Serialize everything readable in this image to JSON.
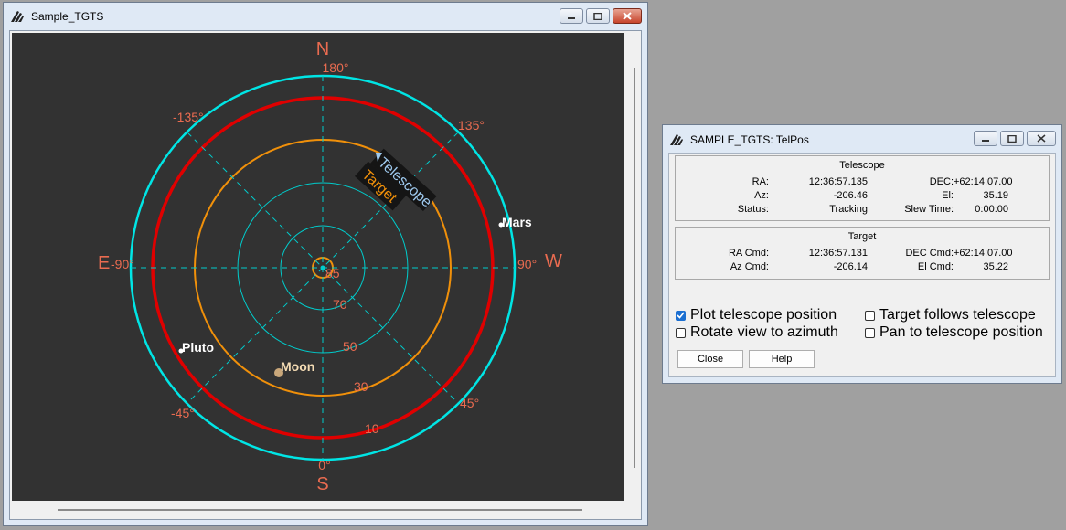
{
  "main_window": {
    "title": "Sample_TGTS",
    "polar": {
      "cardinal": {
        "north": "N",
        "south": "S",
        "east": "E",
        "west": "W"
      },
      "az_labels": {
        "top": "180°",
        "bottom": "0°",
        "left": "-90°",
        "right": "90°",
        "upper_left": "-135°",
        "upper_right": "135°",
        "lower_left": "-45°",
        "lower_right": "45°"
      },
      "el_labels": [
        "85",
        "70",
        "50",
        "30",
        "10"
      ],
      "tags": {
        "telescope": "Telescope",
        "target": "Target"
      },
      "bodies": {
        "mars": "Mars",
        "pluto": "Pluto",
        "moon": "Moon"
      },
      "colors": {
        "outer_ring": "#00e5e5",
        "red_ring": "#e00000",
        "orange_ring": "#f0900a",
        "grid": "#00cccc",
        "labels": "#e96b50"
      }
    }
  },
  "telpos_window": {
    "title": "SAMPLE_TGTS: TelPos",
    "telescope": {
      "heading": "Telescope",
      "ra_label": "RA:",
      "ra_value": "12:36:57.135",
      "dec_label": "DEC:",
      "dec_value": "+62:14:07.00",
      "az_label": "Az:",
      "az_value": "-206.46",
      "el_label": "El:",
      "el_value": "35.19",
      "status_label": "Status:",
      "status_value": "Tracking",
      "slew_label": "Slew Time:",
      "slew_value": "0:00:00"
    },
    "target": {
      "heading": "Target",
      "ra_label": "RA Cmd:",
      "ra_value": "12:36:57.131",
      "dec_label": "DEC Cmd:",
      "dec_value": "+62:14:07.00",
      "az_label": "Az Cmd:",
      "az_value": "-206.14",
      "el_label": "El Cmd:",
      "el_value": "35.22"
    },
    "options": {
      "plot_telescope": {
        "label": "Plot telescope position",
        "checked": true
      },
      "rotate_view": {
        "label": "Rotate view to azimuth",
        "checked": false
      },
      "target_follows": {
        "label": "Target follows telescope",
        "checked": false
      },
      "pan_to_telescope": {
        "label": "Pan to telescope position",
        "checked": false
      }
    },
    "buttons": {
      "close": "Close",
      "help": "Help"
    }
  }
}
